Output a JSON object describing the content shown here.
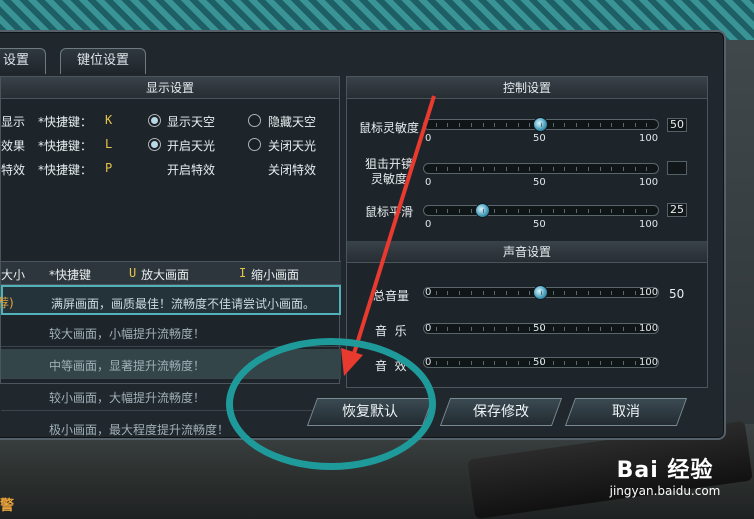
{
  "tabs": [
    {
      "label": "设置"
    },
    {
      "label": "键位设置"
    }
  ],
  "display_settings": {
    "title": "显示设置",
    "rows": [
      {
        "cut_label": "显示",
        "shortcut_label": "*快捷键：",
        "key": "K",
        "opt_a": "显示天空",
        "opt_b": "隐藏天空",
        "selected": "a"
      },
      {
        "cut_label": "效果",
        "shortcut_label": "*快捷键：",
        "key": "L",
        "opt_a": "开启天光",
        "opt_b": "关闭天光",
        "selected": "a"
      },
      {
        "cut_label": "特效",
        "shortcut_label": "*快捷键：",
        "key": "P",
        "opt_a": "开启特效",
        "opt_b": "关闭特效",
        "selected": "none"
      }
    ],
    "zoom": {
      "cut_label": "大小",
      "shortcut_label": "*快捷键",
      "zoom_in_key": "U",
      "zoom_in_label": "放大画面",
      "zoom_out_key": "I",
      "zoom_out_label": "缩小画面"
    },
    "sizes": [
      {
        "tag": "荐)",
        "text": "满屏画面，画质最佳！流畅度不佳请尝试小画面。"
      },
      {
        "tag": "",
        "text": "较大画面，小幅提升流畅度！"
      },
      {
        "tag": "",
        "text": "中等画面，显著提升流畅度！"
      },
      {
        "tag": "",
        "text": "较小画面，大幅提升流畅度！"
      },
      {
        "tag": "",
        "text": "极小画面，最大程度提升流畅度！"
      }
    ]
  },
  "control_settings": {
    "title": "控制设置",
    "sliders": [
      {
        "label": "鼠标灵敏度",
        "value": 50,
        "value_text": "50",
        "min": "0",
        "mid": "50",
        "max": "100"
      },
      {
        "label": "狙击开镜灵敏度",
        "label_line1": "狙击开镜",
        "label_line2": "灵敏度",
        "value": null,
        "value_text": "",
        "min": "0",
        "mid": "50",
        "max": "100"
      },
      {
        "label": "鼠标平滑",
        "value": 25,
        "value_text": "25",
        "min": "0",
        "mid": "50",
        "max": "100"
      }
    ]
  },
  "sound_settings": {
    "title": "声音设置",
    "sliders": [
      {
        "label": "总音量",
        "value": 50,
        "value_text": "50",
        "min": "0",
        "end": "100"
      },
      {
        "label": "音  乐",
        "value": null,
        "value_text": "",
        "min": "0",
        "mid": "50",
        "end": "100"
      },
      {
        "label": "音  效",
        "value": null,
        "value_text": "",
        "min": "0",
        "mid": "50",
        "end": "100"
      }
    ]
  },
  "buttons": {
    "restore": "恢复默认",
    "save": "保存修改",
    "cancel": "取消"
  },
  "watermark": {
    "brand": "Bai 经验",
    "url": "jingyan.baidu.com"
  },
  "corner_text": "警",
  "colors": {
    "accent": "#4fb3b9",
    "key": "#e6c44a",
    "annotation_ellipse": "#1f9a9b",
    "annotation_arrow": "#e83a2f"
  }
}
